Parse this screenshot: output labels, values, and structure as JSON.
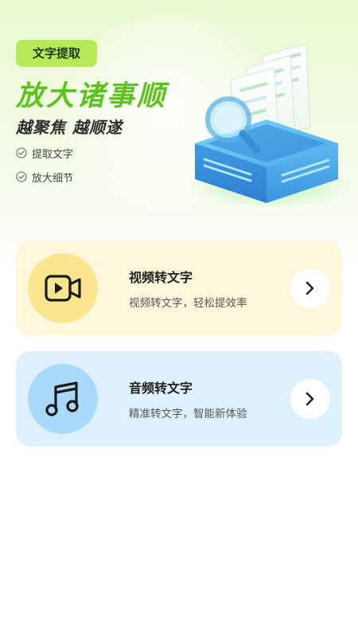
{
  "hero": {
    "tag": "文字提取",
    "headline": "放大诸事顺",
    "subline": "越聚焦 越顺遂",
    "features": [
      "提取文字",
      "放大细节"
    ],
    "illustration_icon": "magnifier-documents-box-icon"
  },
  "cards": [
    {
      "title": "视频转文字",
      "desc": "视频转文字，轻松提效率",
      "icon": "video-camera-icon",
      "accent": "#fbe58e",
      "background": "#fff7dc"
    },
    {
      "title": "音频转文字",
      "desc": "精准转文字，智能新体验",
      "icon": "music-note-icon",
      "accent": "#a9d9fb",
      "background": "#dff0fd"
    }
  ],
  "colors": {
    "brand_green": "#5cc21c",
    "tag_bg": "#b6ea58"
  }
}
